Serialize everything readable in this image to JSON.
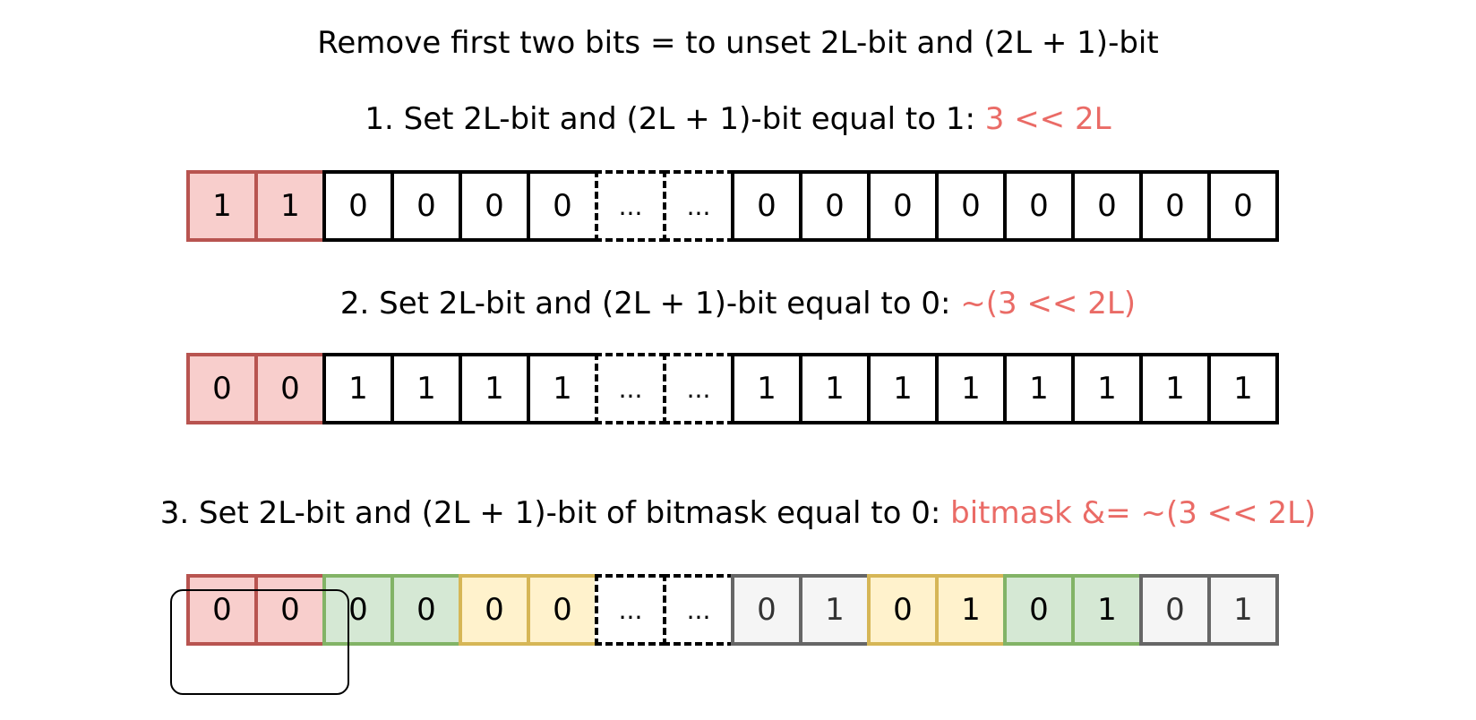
{
  "title": "Remove first two bits = to unset 2L-bit and (2L + 1)-bit",
  "steps": [
    {
      "text": "1. Set 2L-bit and (2L + 1)-bit equal to 1: ",
      "code": "3 << 2L",
      "cells": [
        {
          "v": "1",
          "style": "red"
        },
        {
          "v": "1",
          "style": "red"
        },
        {
          "v": "0",
          "style": "plain"
        },
        {
          "v": "0",
          "style": "plain"
        },
        {
          "v": "0",
          "style": "plain"
        },
        {
          "v": "0",
          "style": "plain"
        },
        {
          "v": "...",
          "style": "dashed"
        },
        {
          "v": "...",
          "style": "dashed"
        },
        {
          "v": "0",
          "style": "plain"
        },
        {
          "v": "0",
          "style": "plain"
        },
        {
          "v": "0",
          "style": "plain"
        },
        {
          "v": "0",
          "style": "plain"
        },
        {
          "v": "0",
          "style": "plain"
        },
        {
          "v": "0",
          "style": "plain"
        },
        {
          "v": "0",
          "style": "plain"
        },
        {
          "v": "0",
          "style": "plain"
        }
      ]
    },
    {
      "text": "2. Set 2L-bit and (2L + 1)-bit equal to 0: ",
      "code": "~(3 << 2L)",
      "cells": [
        {
          "v": "0",
          "style": "red"
        },
        {
          "v": "0",
          "style": "red"
        },
        {
          "v": "1",
          "style": "plain"
        },
        {
          "v": "1",
          "style": "plain"
        },
        {
          "v": "1",
          "style": "plain"
        },
        {
          "v": "1",
          "style": "plain"
        },
        {
          "v": "...",
          "style": "dashed"
        },
        {
          "v": "...",
          "style": "dashed"
        },
        {
          "v": "1",
          "style": "plain"
        },
        {
          "v": "1",
          "style": "plain"
        },
        {
          "v": "1",
          "style": "plain"
        },
        {
          "v": "1",
          "style": "plain"
        },
        {
          "v": "1",
          "style": "plain"
        },
        {
          "v": "1",
          "style": "plain"
        },
        {
          "v": "1",
          "style": "plain"
        },
        {
          "v": "1",
          "style": "plain"
        }
      ]
    },
    {
      "text": "3. Set 2L-bit and (2L + 1)-bit of bitmask equal to 0: ",
      "code": "bitmask &= ~(3 << 2L)",
      "cells": [
        {
          "v": "0",
          "style": "red"
        },
        {
          "v": "0",
          "style": "red"
        },
        {
          "v": "0",
          "style": "green"
        },
        {
          "v": "0",
          "style": "green"
        },
        {
          "v": "0",
          "style": "yellow"
        },
        {
          "v": "0",
          "style": "yellow"
        },
        {
          "v": "...",
          "style": "dashed"
        },
        {
          "v": "...",
          "style": "dashed"
        },
        {
          "v": "0",
          "style": "gray"
        },
        {
          "v": "1",
          "style": "gray"
        },
        {
          "v": "0",
          "style": "yellow"
        },
        {
          "v": "1",
          "style": "yellow"
        },
        {
          "v": "0",
          "style": "green"
        },
        {
          "v": "1",
          "style": "green"
        },
        {
          "v": "0",
          "style": "gray"
        },
        {
          "v": "1",
          "style": "gray"
        }
      ]
    }
  ],
  "colors": {
    "highlight_text": "#ea6b66",
    "red_fill": "#f8cecc",
    "red_stroke": "#b85450",
    "green_fill": "#d5e8d4",
    "green_stroke": "#82b366",
    "yellow_fill": "#fff2cc",
    "yellow_stroke": "#d6b656",
    "gray_fill": "#f5f5f5",
    "gray_stroke": "#666666"
  }
}
